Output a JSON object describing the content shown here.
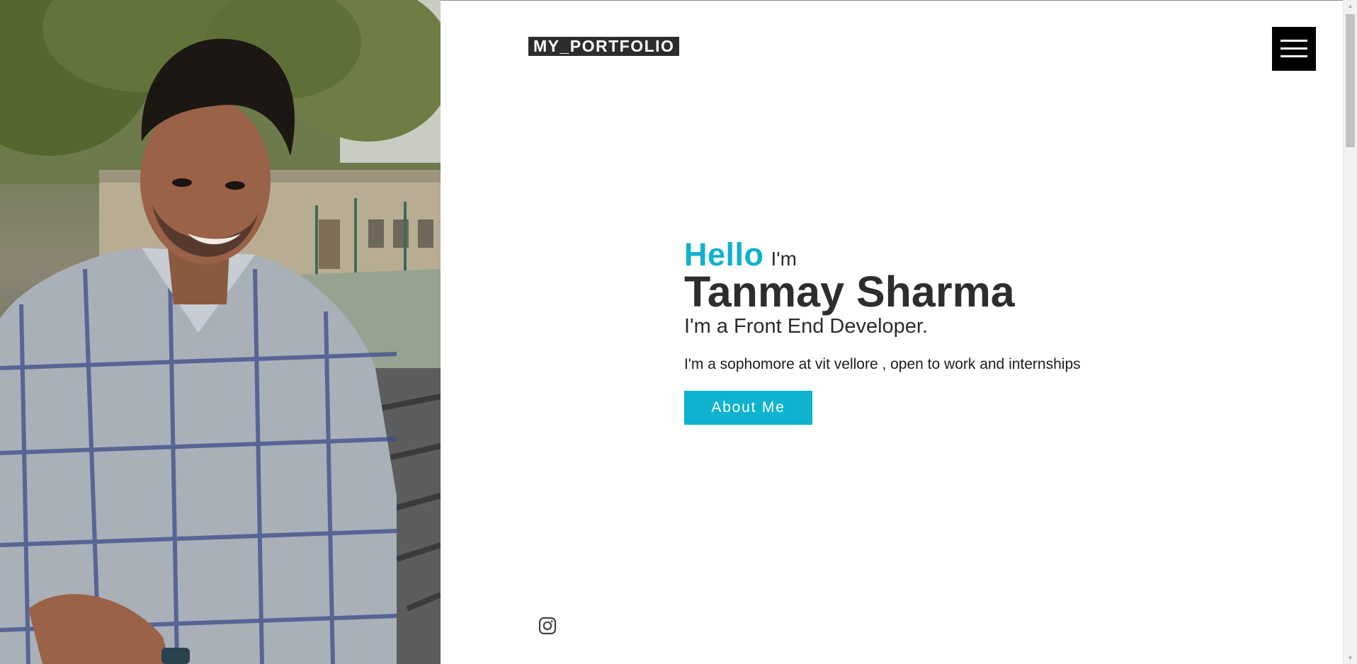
{
  "header": {
    "logo": "MY_PORTFOLIO",
    "menu_icon": "hamburger-menu-icon"
  },
  "hero": {
    "hello": "Hello",
    "im": "I'm",
    "name": "Tanmay Sharma",
    "role": "I'm a Front End Developer.",
    "description": "I'm a sophomore at vit vellore , open to work and internships",
    "button_label": "About Me"
  },
  "social": {
    "instagram_icon": "instagram-icon"
  },
  "colors": {
    "accent": "#0fb2cf",
    "logo_bg": "#2d2d2d",
    "menu_bg": "#000000",
    "text": "#2b2b2b"
  }
}
